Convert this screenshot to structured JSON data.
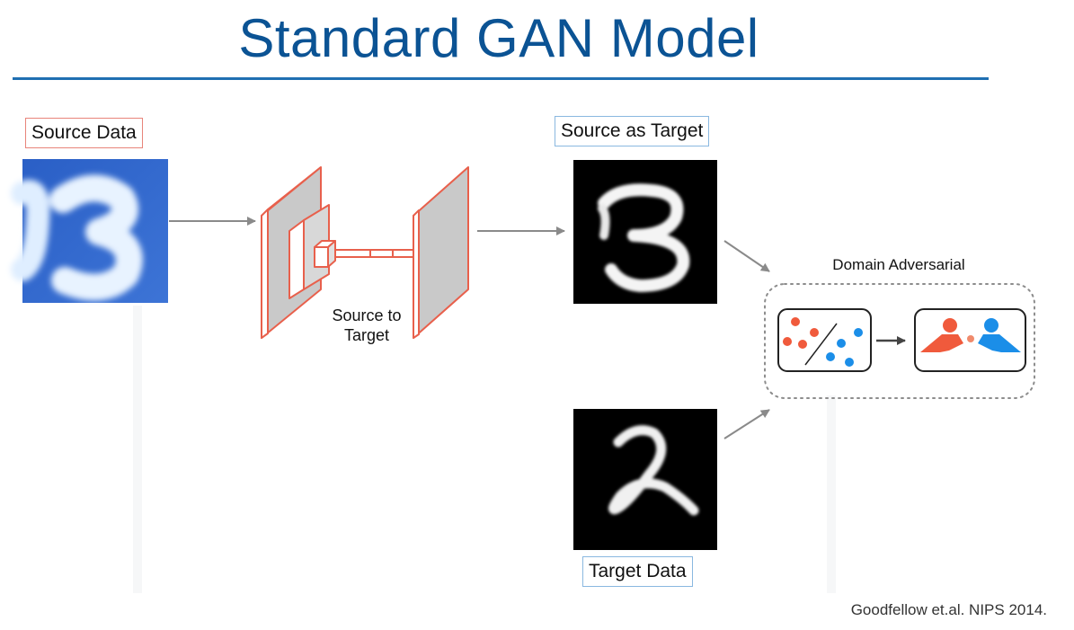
{
  "title": "Standard GAN Model",
  "labels": {
    "source_data": "Source Data",
    "source_as_target": "Source as Target",
    "target_data": "Target Data",
    "source_to_target": "Source to\nTarget",
    "domain_adversarial": "Domain Adversarial"
  },
  "citation": "Goodfellow et.al. NIPS 2014.",
  "colors": {
    "title": "#0b5394",
    "accent_red": "#f05a3c",
    "accent_blue": "#1b8ee8",
    "svhn_blue": "#2f63c8"
  }
}
